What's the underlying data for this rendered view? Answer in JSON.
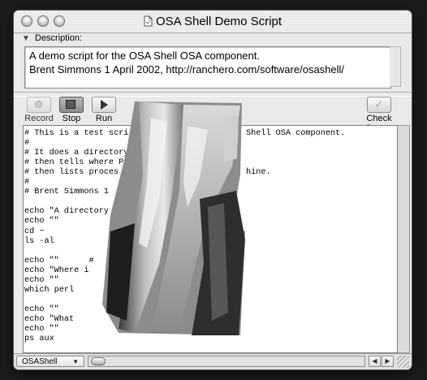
{
  "window": {
    "title": "OSA Shell Demo Script"
  },
  "description": {
    "label": "Description:",
    "lines": [
      "A demo script for the OSA Shell OSA component.",
      "Brent Simmons 1 April 2002, http://ranchero.com/software/osashell/"
    ]
  },
  "toolbar": {
    "record_label": "Record",
    "stop_label": "Stop",
    "run_label": "Run",
    "check_syntax_label": "Check Syntax"
  },
  "script": {
    "lines": [
      "# This is a test scri",
      "#",
      "# It does a directory",
      "# then tells where P",
      "# then lists proces",
      "#",
      "# Brent Simmons 1",
      "",
      "echo \"A directory",
      "echo \"\"",
      "cd ~",
      "ls -al",
      "",
      "echo \"\"      #",
      "echo \"Where i",
      "echo \"\"",
      "which perl",
      "",
      "echo \"\"",
      "echo \"What",
      "echo \"\"",
      "ps aux"
    ],
    "fragments": [
      "Shell OSA component.",
      "hine.",
      ".\""
    ]
  },
  "bottom": {
    "language_popup": "OSAShell"
  },
  "icons": {
    "close": "close-button-icon",
    "minimize": "minimize-button-icon",
    "zoom": "zoom-button-icon",
    "document": "document-icon",
    "disclosure": "disclosure-triangle-icon",
    "record": "record-icon",
    "stop": "stop-icon",
    "run": "play-icon",
    "check": "checkmark-icon"
  }
}
